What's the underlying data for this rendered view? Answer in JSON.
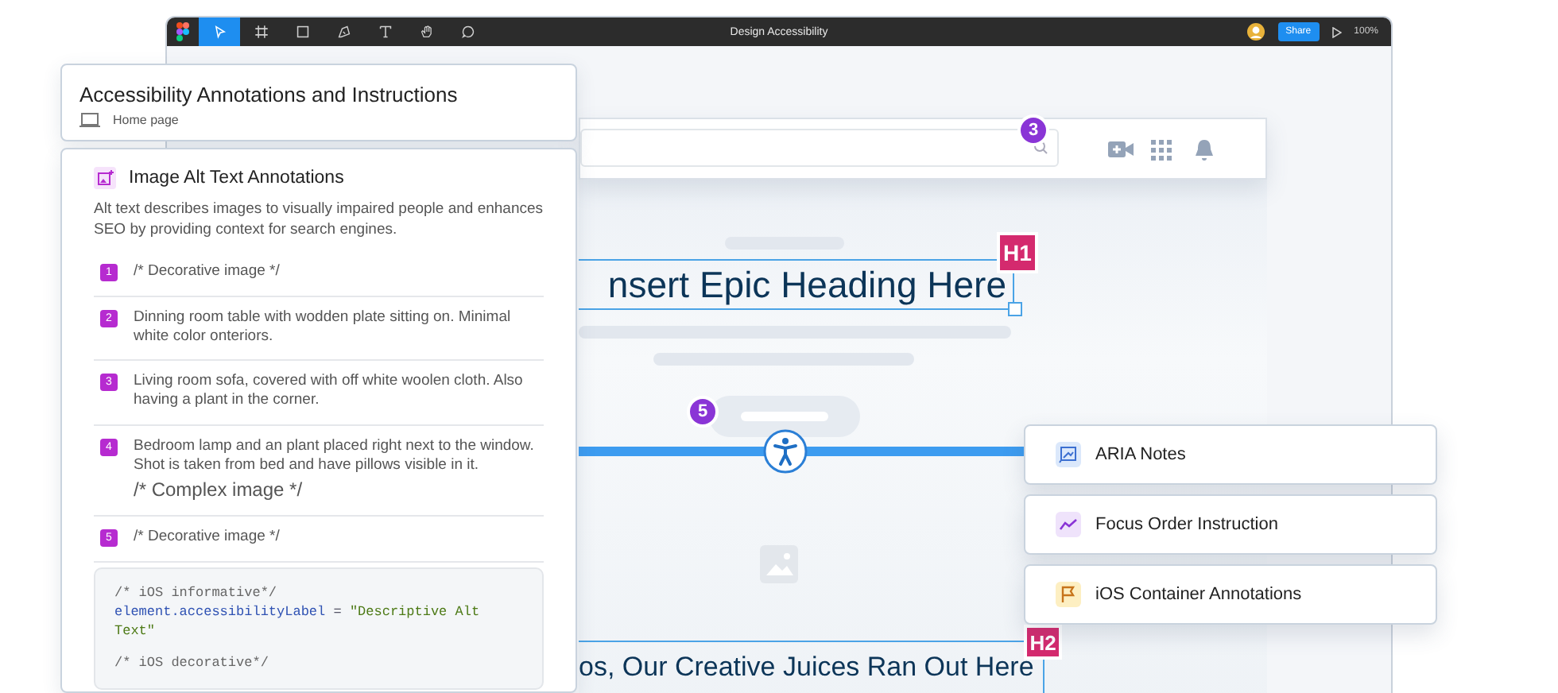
{
  "window": {
    "title": "Design Accessibility",
    "share_button": "Share",
    "zoom": "100%",
    "tools": [
      {
        "kind": "move",
        "selected": true
      },
      {
        "kind": "frame",
        "selected": false
      },
      {
        "kind": "shape",
        "selected": false
      },
      {
        "kind": "pen",
        "selected": false
      },
      {
        "kind": "text",
        "selected": false
      },
      {
        "kind": "hand",
        "selected": false
      },
      {
        "kind": "comment",
        "selected": false
      }
    ]
  },
  "header_panel": {
    "title": "Accessibility Annotations and Instructions",
    "subtitle": "Home page"
  },
  "alt_text_panel": {
    "title": "Image Alt Text Annotations",
    "description": "Alt text describes images to visually impaired people and enhances SEO by providing context for search engines.",
    "items": [
      {
        "number": "1",
        "text": "/* Decorative image */"
      },
      {
        "number": "2",
        "text": "Dinning room table with wodden plate sitting on. Minimal white color onteriors."
      },
      {
        "number": "3",
        "text": "Living room sofa, covered with off white woolen cloth. Also having a plant in the corner."
      },
      {
        "number": "4",
        "text": "Bedroom lamp and an plant placed right next to the window. Shot is taken from bed and have pillows visible in it.",
        "note": "/* Complex image */"
      },
      {
        "number": "5",
        "text": "/* Decorative image */"
      }
    ],
    "code_lines": [
      {
        "kind": "comment",
        "text": "/* iOS informative*/"
      },
      {
        "kind": "assignment",
        "target": "element.accessibilityLabel",
        "operator": "=",
        "value": "\"Descriptive Alt Text\""
      },
      {
        "kind": "comment",
        "text": "/* iOS decorative*/"
      }
    ]
  },
  "canvas": {
    "search_marker": "3",
    "heading": {
      "text": "nsert Epic Heading Here",
      "badge": "H1"
    },
    "button_marker": "5",
    "subheading": {
      "text": "os, Our Creative Juices Ran Out Here",
      "badge": "H2"
    }
  },
  "annotation_cards": [
    {
      "kind": "aria",
      "label": "ARIA Notes"
    },
    {
      "kind": "focus",
      "label": "Focus Order Instruction"
    },
    {
      "kind": "container",
      "label": "iOS Container Annotations"
    }
  ]
}
